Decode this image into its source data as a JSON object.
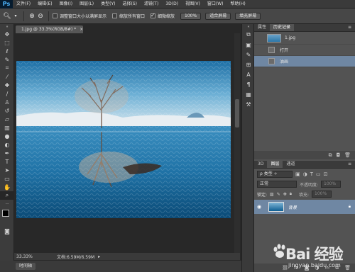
{
  "app": {
    "logo": "Ps"
  },
  "menu": [
    "文件(F)",
    "编辑(E)",
    "图像(I)",
    "图层(L)",
    "类型(Y)",
    "选择(S)",
    "滤镜(T)",
    "3D(D)",
    "视图(V)",
    "窗口(W)",
    "帮助(H)"
  ],
  "options": {
    "resize_windows_label": "调整窗口大小以满屏显示",
    "zoom_all_label": "缩放所有窗口",
    "scrubby_zoom_label": "细微缩放",
    "scrubby_zoom_checked": true,
    "btn_100": "100%",
    "btn_fit": "适合屏幕",
    "btn_fill": "填充屏幕"
  },
  "document": {
    "tab_title": "1.jpg @ 33.3%(RGB/8#) *",
    "zoom": "33.33%",
    "doc_info": "文档:6.59M/6.59M"
  },
  "timeline_label": "时间轴",
  "history_panel": {
    "tabs": [
      "属性",
      "历史记录"
    ],
    "active_tab": 1,
    "snapshot_name": "1.jpg",
    "items": [
      {
        "label": "打开",
        "selected": false
      },
      {
        "label": "油画",
        "selected": true
      }
    ]
  },
  "layers_panel": {
    "tabs": [
      "3D",
      "图层",
      "通道"
    ],
    "active_tab": 1,
    "kind_filter": "ρ 类型 ÷",
    "blend_mode": "正常",
    "opacity_label": "不透明度:",
    "opacity_value": "100%",
    "lock_label": "锁定:",
    "fill_label": "填充:",
    "fill_value": "100%",
    "layers": [
      {
        "name": "背景",
        "visible": true,
        "locked": true
      }
    ]
  },
  "watermark": {
    "brand": "Bai 经验",
    "url": "jingyan.baidu.com"
  },
  "colors": {
    "accent_selection": "#6f87a3",
    "panel_bg": "#535353",
    "workspace_bg": "#282828"
  }
}
